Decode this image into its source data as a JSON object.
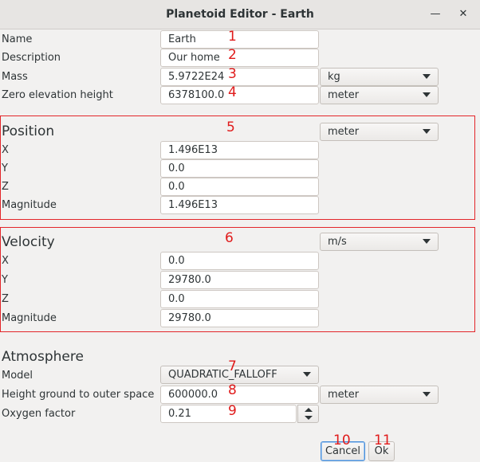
{
  "window": {
    "title": "Planetoid Editor - Earth",
    "minimize_icon": "minimize-icon",
    "close_icon": "close-icon"
  },
  "general": {
    "name_label": "Name",
    "name_value": "Earth",
    "description_label": "Description",
    "description_value": "Our home",
    "mass_label": "Mass",
    "mass_value": "5.9722E24",
    "mass_unit": "kg",
    "zero_label": "Zero elevation height",
    "zero_value": "6378100.0",
    "zero_unit": "meter"
  },
  "position": {
    "heading": "Position",
    "unit": "meter",
    "x_label": "X",
    "x_value": "1.496E13",
    "y_label": "Y",
    "y_value": "0.0",
    "z_label": "Z",
    "z_value": "0.0",
    "mag_label": "Magnitude",
    "mag_value": "1.496E13"
  },
  "velocity": {
    "heading": "Velocity",
    "unit": "m/s",
    "x_label": "X",
    "x_value": "0.0",
    "y_label": "Y",
    "y_value": "29780.0",
    "z_label": "Z",
    "z_value": "0.0",
    "mag_label": "Magnitude",
    "mag_value": "29780.0"
  },
  "atmosphere": {
    "heading": "Atmosphere",
    "model_label": "Model",
    "model_value": "QUADRATIC_FALLOFF",
    "height_label": "Height ground to outer space",
    "height_value": "600000.0",
    "height_unit": "meter",
    "oxygen_label": "Oxygen factor",
    "oxygen_value": "0.21"
  },
  "buttons": {
    "cancel": "Cancel",
    "ok": "Ok"
  },
  "annotations": [
    "1",
    "2",
    "3",
    "4",
    "5",
    "6",
    "7",
    "8",
    "9",
    "10",
    "11"
  ],
  "colors": {
    "annotation": "#e01b1b",
    "focus": "#4a90d9"
  }
}
